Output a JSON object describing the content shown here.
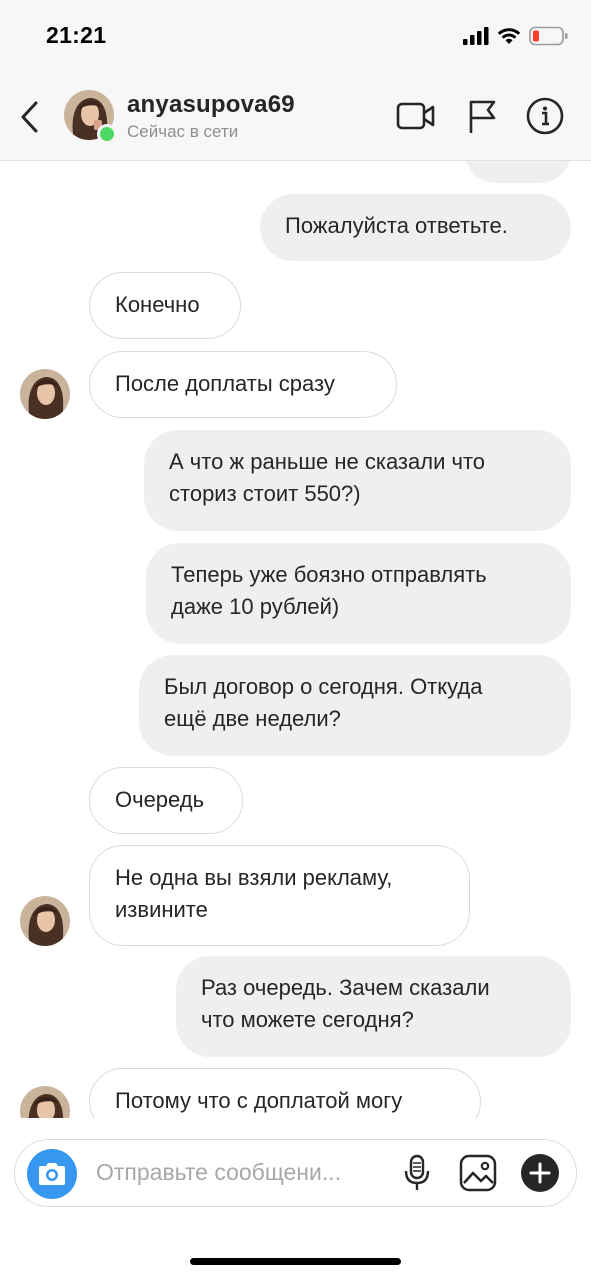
{
  "status_bar": {
    "time": "21:21"
  },
  "header": {
    "username": "anyasupova69",
    "presence": "Сейчас в сети"
  },
  "messages": [
    {
      "from": "me",
      "text": "Пожалуйста ответьте."
    },
    {
      "from": "them",
      "text": "Конечно"
    },
    {
      "from": "them",
      "text": "После доплаты сразу"
    },
    {
      "from": "me",
      "lines": [
        "А что ж раньше не сказали что",
        "сториз стоит 550?)"
      ]
    },
    {
      "from": "me",
      "lines": [
        "Теперь уже боязно отправлять",
        "даже 10 рублей)"
      ]
    },
    {
      "from": "me",
      "lines": [
        "Был договор о сегодня. Откуда",
        "ещё две недели?"
      ]
    },
    {
      "from": "them",
      "text": "Очередь"
    },
    {
      "from": "them",
      "lines": [
        "Не одна вы взяли рекламу,",
        "извините"
      ]
    },
    {
      "from": "me",
      "lines": [
        "Раз очередь. Зачем сказали",
        "что можете сегодня?"
      ]
    },
    {
      "from": "them",
      "text": "Потому что с доплатой могу"
    }
  ],
  "composer": {
    "placeholder": "Отправьте сообщени..."
  },
  "colors": {
    "outgoing_bubble": "#efefef",
    "incoming_border": "#dbdbdb",
    "online": "#4cd964",
    "camera_button": "#3797f0",
    "battery_low": "#ff3b30"
  },
  "icons": [
    "back-icon",
    "video-call-icon",
    "flag-icon",
    "info-icon",
    "camera-icon",
    "microphone-icon",
    "gallery-icon",
    "add-icon",
    "signal-icon",
    "wifi-icon",
    "battery-icon"
  ]
}
